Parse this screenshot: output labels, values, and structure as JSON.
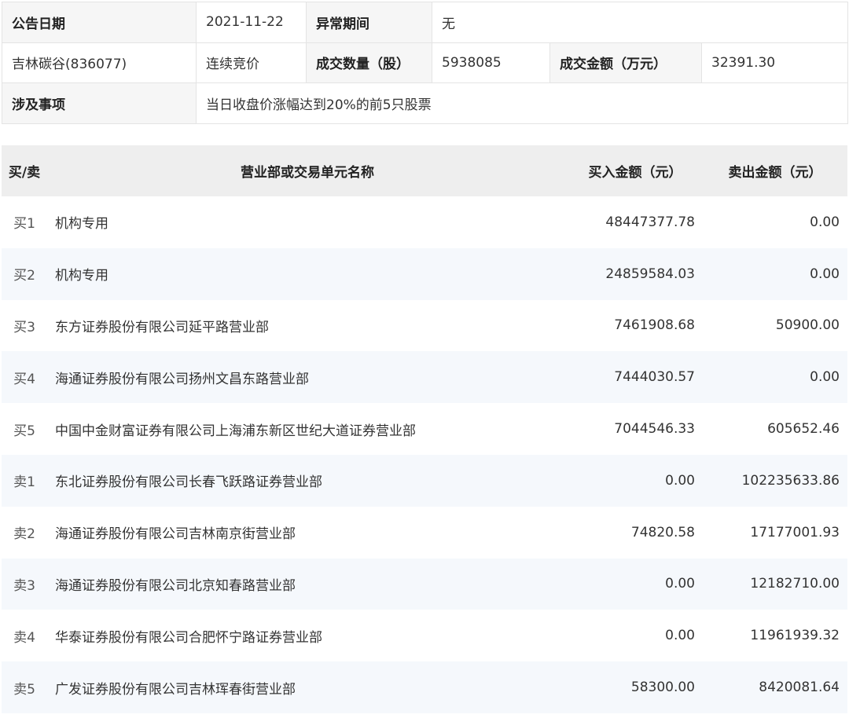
{
  "info": {
    "announce_date_label": "公告日期",
    "announce_date_value": "2021-11-22",
    "abnormal_period_label": "异常期间",
    "abnormal_period_value": "无",
    "stock_name": "吉林碳谷(836077)",
    "trade_method": "连续竞价",
    "volume_label": "成交数量（股）",
    "volume_value": "5938085",
    "turnover_label": "成交金额（万元）",
    "turnover_value": "32391.30",
    "matter_label": "涉及事项",
    "matter_value": "当日收盘价涨幅达到20%的前5只股票"
  },
  "trades": {
    "headers": {
      "side": "买/卖",
      "name": "营业部或交易单元名称",
      "buy": "买入金额（元）",
      "sell": "卖出金额（元）"
    },
    "rows": [
      {
        "side": "买1",
        "name": "机构专用",
        "buy": "48447377.78",
        "sell": "0.00"
      },
      {
        "side": "买2",
        "name": "机构专用",
        "buy": "24859584.03",
        "sell": "0.00"
      },
      {
        "side": "买3",
        "name": "东方证券股份有限公司延平路营业部",
        "buy": "7461908.68",
        "sell": "50900.00"
      },
      {
        "side": "买4",
        "name": "海通证券股份有限公司扬州文昌东路营业部",
        "buy": "7444030.57",
        "sell": "0.00"
      },
      {
        "side": "买5",
        "name": "中国中金财富证券有限公司上海浦东新区世纪大道证券营业部",
        "buy": "7044546.33",
        "sell": "605652.46"
      },
      {
        "side": "卖1",
        "name": "东北证券股份有限公司长春飞跃路证券营业部",
        "buy": "0.00",
        "sell": "102235633.86"
      },
      {
        "side": "卖2",
        "name": "海通证券股份有限公司吉林南京街营业部",
        "buy": "74820.58",
        "sell": "17177001.93"
      },
      {
        "side": "卖3",
        "name": "海通证券股份有限公司北京知春路营业部",
        "buy": "0.00",
        "sell": "12182710.00"
      },
      {
        "side": "卖4",
        "name": "华泰证券股份有限公司合肥怀宁路证券营业部",
        "buy": "0.00",
        "sell": "11961939.32"
      },
      {
        "side": "卖5",
        "name": "广发证券股份有限公司吉林珲春街营业部",
        "buy": "58300.00",
        "sell": "8420081.64"
      }
    ]
  }
}
